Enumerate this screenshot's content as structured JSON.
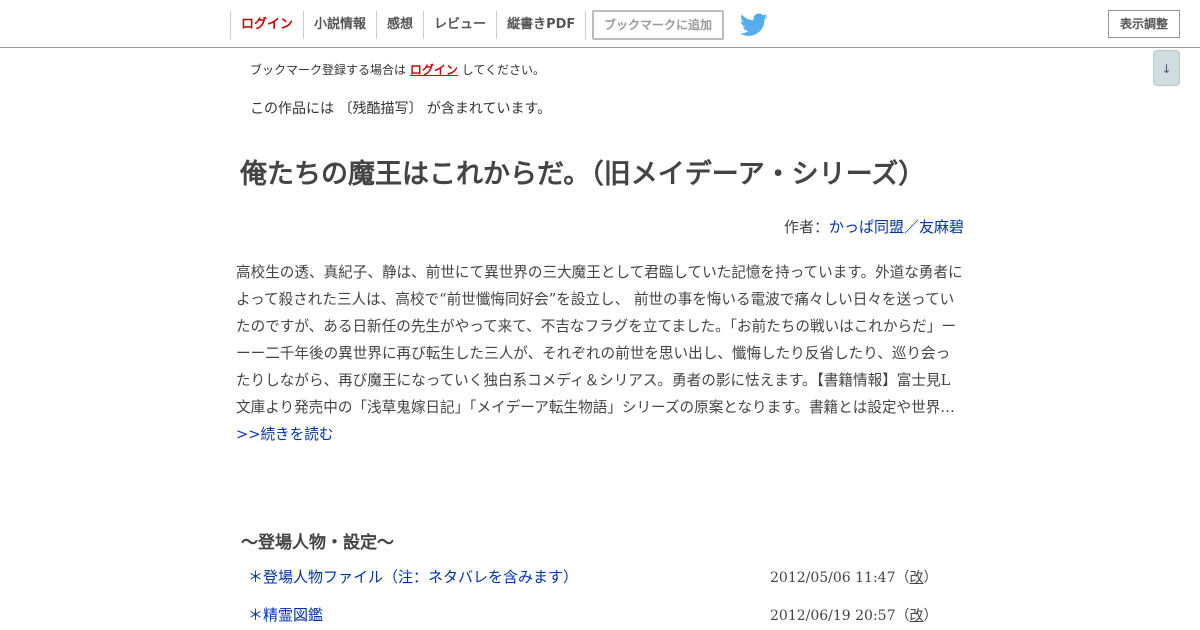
{
  "nav": {
    "items": [
      {
        "label": "ログイン"
      },
      {
        "label": "小説情報"
      },
      {
        "label": "感想"
      },
      {
        "label": "レビュー"
      },
      {
        "label": "縦書きPDF"
      }
    ],
    "bookmark_label": "ブックマークに追加",
    "twitter_icon": "twitter-bird-icon",
    "display_label": "表示調整",
    "scroll_down_label": "↓"
  },
  "notice": {
    "prefix": "ブックマーク登録する場合は",
    "login_link": "ログイン",
    "suffix": "してください。"
  },
  "warning": "この作品には 〔残酷描写〕 が含まれています。",
  "novel": {
    "title": "俺たちの魔王はこれからだ。（旧メイデーア・シリーズ）",
    "author_prefix": "作者：",
    "author": "かっぱ同盟／友麻碧",
    "synopsis": "高校生の透、真紀子、静は、前世にて異世界の三大魔王として君臨していた記憶を持っています。外道な勇者によって殺された三人は、高校で“前世懺悔同好会”を設立し、 前世の事を悔いる電波で痛々しい日々を送っていたのですが、ある日新任の先生がやって来て、不吉なフラグを立てました。「お前たちの戦いはこれからだ」ーーー二千年後の異世界に再び転生した三人が、それぞれの前世を思い出し、懺悔したり反省したり、巡り会ったりしながら、再び魔王になっていく独白系コメディ＆シリアス。勇者の影に怯えます。【書籍情報】富士見L文庫より発売中の「浅草鬼嫁日記」「メイデーア転生物語」シリーズの原案となります。書籍とは設定や世界…",
    "more_link": ">>続きを読む"
  },
  "chapter": {
    "title": "〜登場人物・設定〜",
    "episodes": [
      {
        "title": "＊登場人物ファイル（注：ネタバレを含みます）",
        "date": "2012/05/06 11:47",
        "rev_open": "（",
        "rev": "改",
        "rev_close": "）"
      },
      {
        "title": "＊精霊図鑑",
        "date": "2012/06/19 20:57",
        "rev_open": "（",
        "rev": "改",
        "rev_close": "）"
      }
    ]
  },
  "colors": {
    "link": "#0033aa",
    "login": "#cc0000",
    "twitter": "#55acee"
  }
}
